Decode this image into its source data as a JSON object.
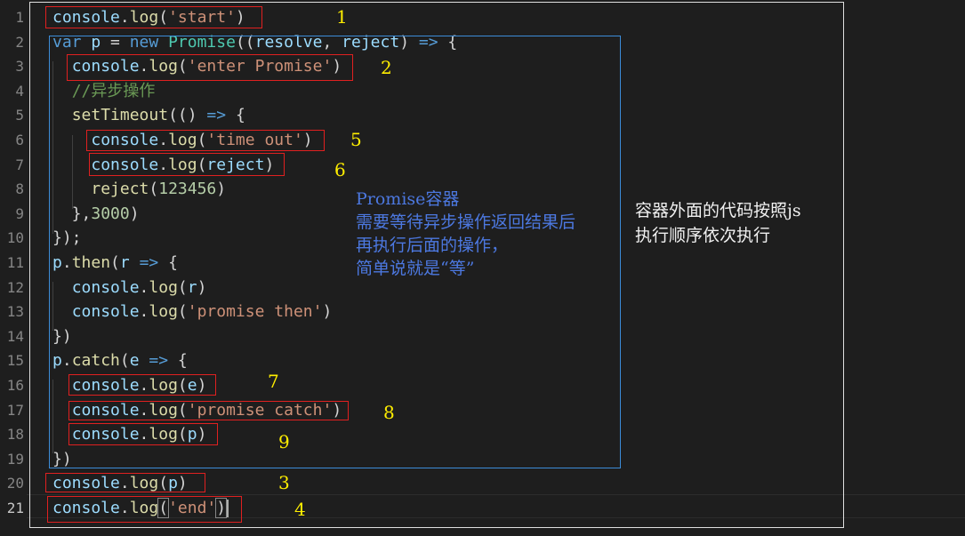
{
  "editor": {
    "line_numbers": [
      "1",
      "2",
      "3",
      "4",
      "5",
      "6",
      "7",
      "8",
      "9",
      "10",
      "11",
      "12",
      "13",
      "14",
      "15",
      "16",
      "17",
      "18",
      "19",
      "20",
      "21"
    ],
    "active_line": "21",
    "lines": [
      [
        {
          "t": "console",
          "c": "var"
        },
        {
          "t": ".",
          "c": "p"
        },
        {
          "t": "log",
          "c": "fn"
        },
        {
          "t": "(",
          "c": "p"
        },
        {
          "t": "'start'",
          "c": "str"
        },
        {
          "t": ")",
          "c": "p"
        }
      ],
      [
        {
          "t": "var",
          "c": "kw"
        },
        {
          "t": " ",
          "c": "p"
        },
        {
          "t": "p",
          "c": "var"
        },
        {
          "t": " = ",
          "c": "p"
        },
        {
          "t": "new",
          "c": "kw"
        },
        {
          "t": " ",
          "c": "p"
        },
        {
          "t": "Promise",
          "c": "cls"
        },
        {
          "t": "((",
          "c": "p"
        },
        {
          "t": "resolve",
          "c": "var"
        },
        {
          "t": ", ",
          "c": "p"
        },
        {
          "t": "reject",
          "c": "var"
        },
        {
          "t": ") ",
          "c": "p"
        },
        {
          "t": "=>",
          "c": "op"
        },
        {
          "t": " {",
          "c": "p"
        }
      ],
      [
        {
          "t": "  ",
          "c": "p"
        },
        {
          "t": "console",
          "c": "var"
        },
        {
          "t": ".",
          "c": "p"
        },
        {
          "t": "log",
          "c": "fn"
        },
        {
          "t": "(",
          "c": "p"
        },
        {
          "t": "'enter Promise'",
          "c": "str"
        },
        {
          "t": ")",
          "c": "p"
        }
      ],
      [
        {
          "t": "  ",
          "c": "p"
        },
        {
          "t": "//异步操作",
          "c": "cmt"
        }
      ],
      [
        {
          "t": "  ",
          "c": "p"
        },
        {
          "t": "setTimeout",
          "c": "fn"
        },
        {
          "t": "(() ",
          "c": "p"
        },
        {
          "t": "=>",
          "c": "op"
        },
        {
          "t": " {",
          "c": "p"
        }
      ],
      [
        {
          "t": "    ",
          "c": "p"
        },
        {
          "t": "console",
          "c": "var"
        },
        {
          "t": ".",
          "c": "p"
        },
        {
          "t": "log",
          "c": "fn"
        },
        {
          "t": "(",
          "c": "p"
        },
        {
          "t": "'time out'",
          "c": "str"
        },
        {
          "t": ")",
          "c": "p"
        }
      ],
      [
        {
          "t": "    ",
          "c": "p"
        },
        {
          "t": "console",
          "c": "var"
        },
        {
          "t": ".",
          "c": "p"
        },
        {
          "t": "log",
          "c": "fn"
        },
        {
          "t": "(",
          "c": "p"
        },
        {
          "t": "reject",
          "c": "var"
        },
        {
          "t": ")",
          "c": "p"
        }
      ],
      [
        {
          "t": "    ",
          "c": "p"
        },
        {
          "t": "reject",
          "c": "fn"
        },
        {
          "t": "(",
          "c": "p"
        },
        {
          "t": "123456",
          "c": "num"
        },
        {
          "t": ")",
          "c": "p"
        }
      ],
      [
        {
          "t": "  },",
          "c": "p"
        },
        {
          "t": "3000",
          "c": "num"
        },
        {
          "t": ")",
          "c": "p"
        }
      ],
      [
        {
          "t": "});",
          "c": "p"
        }
      ],
      [
        {
          "t": "p",
          "c": "var"
        },
        {
          "t": ".",
          "c": "p"
        },
        {
          "t": "then",
          "c": "fn"
        },
        {
          "t": "(",
          "c": "p"
        },
        {
          "t": "r",
          "c": "var"
        },
        {
          "t": " ",
          "c": "p"
        },
        {
          "t": "=>",
          "c": "op"
        },
        {
          "t": " {",
          "c": "p"
        }
      ],
      [
        {
          "t": "  ",
          "c": "p"
        },
        {
          "t": "console",
          "c": "var"
        },
        {
          "t": ".",
          "c": "p"
        },
        {
          "t": "log",
          "c": "fn"
        },
        {
          "t": "(",
          "c": "p"
        },
        {
          "t": "r",
          "c": "var"
        },
        {
          "t": ")",
          "c": "p"
        }
      ],
      [
        {
          "t": "  ",
          "c": "p"
        },
        {
          "t": "console",
          "c": "var"
        },
        {
          "t": ".",
          "c": "p"
        },
        {
          "t": "log",
          "c": "fn"
        },
        {
          "t": "(",
          "c": "p"
        },
        {
          "t": "'promise then'",
          "c": "str"
        },
        {
          "t": ")",
          "c": "p"
        }
      ],
      [
        {
          "t": "})",
          "c": "p"
        }
      ],
      [
        {
          "t": "p",
          "c": "var"
        },
        {
          "t": ".",
          "c": "p"
        },
        {
          "t": "catch",
          "c": "fn"
        },
        {
          "t": "(",
          "c": "p"
        },
        {
          "t": "e",
          "c": "var"
        },
        {
          "t": " ",
          "c": "p"
        },
        {
          "t": "=>",
          "c": "op"
        },
        {
          "t": " {",
          "c": "p"
        }
      ],
      [
        {
          "t": "  ",
          "c": "p"
        },
        {
          "t": "console",
          "c": "var"
        },
        {
          "t": ".",
          "c": "p"
        },
        {
          "t": "log",
          "c": "fn"
        },
        {
          "t": "(",
          "c": "p"
        },
        {
          "t": "e",
          "c": "var"
        },
        {
          "t": ")",
          "c": "p"
        }
      ],
      [
        {
          "t": "  ",
          "c": "p"
        },
        {
          "t": "console",
          "c": "var"
        },
        {
          "t": ".",
          "c": "p"
        },
        {
          "t": "log",
          "c": "fn"
        },
        {
          "t": "(",
          "c": "p"
        },
        {
          "t": "'promise catch'",
          "c": "str"
        },
        {
          "t": ")",
          "c": "p"
        }
      ],
      [
        {
          "t": "  ",
          "c": "p"
        },
        {
          "t": "console",
          "c": "var"
        },
        {
          "t": ".",
          "c": "p"
        },
        {
          "t": "log",
          "c": "fn"
        },
        {
          "t": "(",
          "c": "p"
        },
        {
          "t": "p",
          "c": "var"
        },
        {
          "t": ")",
          "c": "p"
        }
      ],
      [
        {
          "t": "})",
          "c": "p"
        }
      ],
      [
        {
          "t": "console",
          "c": "var"
        },
        {
          "t": ".",
          "c": "p"
        },
        {
          "t": "log",
          "c": "fn"
        },
        {
          "t": "(",
          "c": "p"
        },
        {
          "t": "p",
          "c": "var"
        },
        {
          "t": ")",
          "c": "p"
        }
      ],
      [
        {
          "t": "console",
          "c": "var"
        },
        {
          "t": ".",
          "c": "p"
        },
        {
          "t": "log",
          "c": "fn"
        },
        {
          "t": "(",
          "c": "bracket"
        },
        {
          "t": "'end'",
          "c": "str"
        },
        {
          "t": ")",
          "c": "bracket"
        },
        {
          "t": "",
          "c": "cursor"
        }
      ]
    ]
  },
  "annotations": {
    "order_labels": [
      "1",
      "2",
      "5",
      "6",
      "7",
      "8",
      "9",
      "3",
      "4"
    ],
    "blue_note": "Promise容器\n需要等待异步操作返回结果后\n再执行后面的操作，\n简单说就是“等”",
    "white_note": "容器外面的代码按照js\n执行顺序依次执行"
  },
  "colors": {
    "background": "#1e1e1e",
    "highlight_box": "#e02020",
    "container_box": "#3c8cd8",
    "order_number": "#ffee00",
    "blue_note": "#4c78e0"
  }
}
